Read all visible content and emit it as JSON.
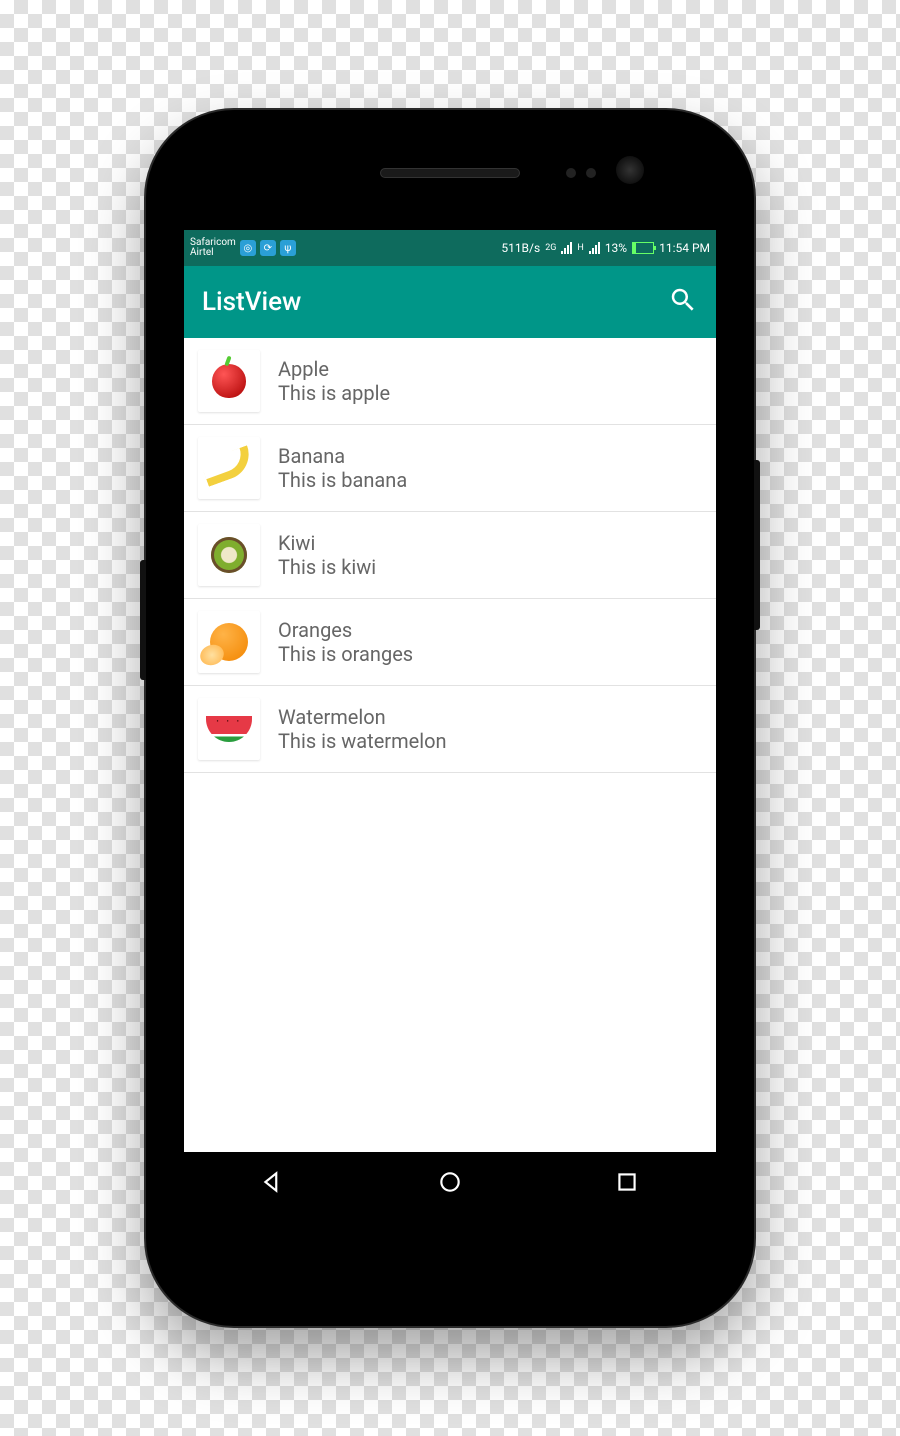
{
  "status": {
    "carrier1": "Safaricom",
    "carrier2": "Airtel",
    "data_rate": "511B/s",
    "net_badge": "2G",
    "net_badge2": "H",
    "battery_pct": "13%",
    "clock": "11:54 PM"
  },
  "appbar": {
    "title": "ListView"
  },
  "list": [
    {
      "icon": "apple-icon",
      "title": "Apple",
      "subtitle": "This is apple"
    },
    {
      "icon": "banana-icon",
      "title": "Banana",
      "subtitle": "This is banana"
    },
    {
      "icon": "kiwi-icon",
      "title": "Kiwi",
      "subtitle": "This is kiwi"
    },
    {
      "icon": "orange-icon",
      "title": "Oranges",
      "subtitle": "This is oranges"
    },
    {
      "icon": "watermelon-icon",
      "title": "Watermelon",
      "subtitle": "This is watermelon"
    }
  ],
  "colors": {
    "primary": "#009688",
    "primary_dark": "#0e6b5d",
    "text": "#666"
  }
}
